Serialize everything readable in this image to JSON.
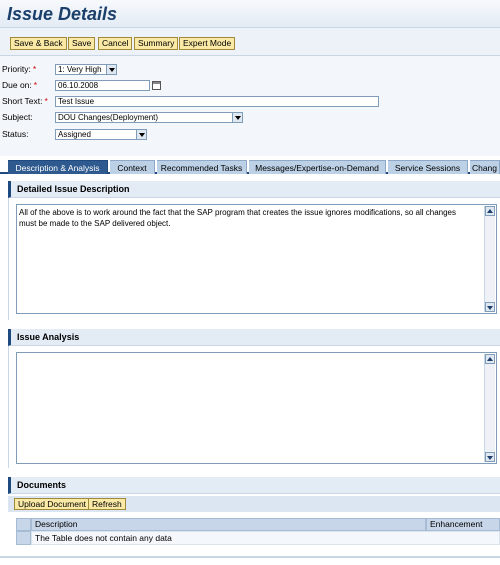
{
  "header": {
    "title": "Issue Details"
  },
  "toolbar": {
    "save_back": "Save & Back",
    "save": "Save",
    "cancel": "Cancel",
    "summary": "Summary",
    "expert_mode": "Expert Mode"
  },
  "form": {
    "priority": {
      "label": "Priority:",
      "value": "1: Very High"
    },
    "due_on": {
      "label": "Due on:",
      "value": "06.10.2008"
    },
    "short_text": {
      "label": "Short Text:",
      "value": "Test Issue"
    },
    "subject": {
      "label": "Subject:",
      "value": "DOU Changes(Deployment)"
    },
    "status": {
      "label": "Status:",
      "value": "Assigned"
    },
    "required_marker": "*"
  },
  "tabs": [
    {
      "label": "Description & Analysis"
    },
    {
      "label": "Context"
    },
    {
      "label": "Recommended Tasks"
    },
    {
      "label": "Messages/Expertise-on-Demand"
    },
    {
      "label": "Service Sessions"
    },
    {
      "label": "Chang"
    }
  ],
  "detailed_description": {
    "title": "Detailed Issue Description",
    "text": "All of the above is to work around the fact that the SAP program that creates the issue ignores modifications, so all changes must be made to the SAP delivered object."
  },
  "issue_analysis": {
    "title": "Issue Analysis",
    "text": ""
  },
  "documents": {
    "title": "Documents",
    "upload": "Upload Document",
    "refresh": "Refresh",
    "columns": [
      "Description",
      "Enhancement"
    ],
    "empty_text": "The Table does not contain any data"
  },
  "colors": {
    "accent": "#1f4a80",
    "button": "#fbe9a6",
    "active_tab": "#2e5a8f"
  }
}
